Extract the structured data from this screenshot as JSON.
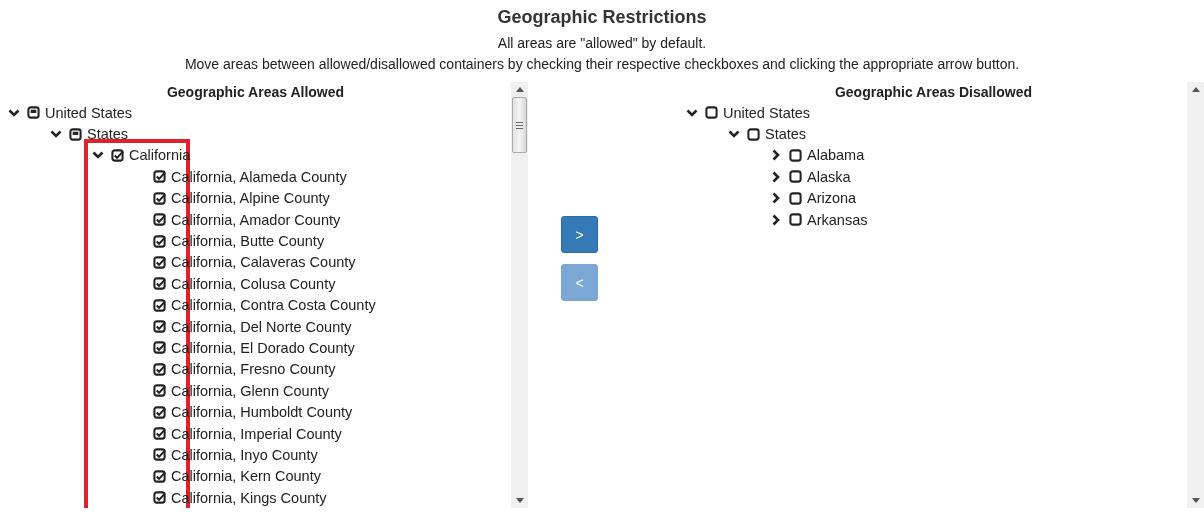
{
  "title": "Geographic Restrictions",
  "intro": [
    "All areas are \"allowed\" by default.",
    "Move areas between allowed/disallowed containers by checking their respective checkboxes and clicking the appropriate arrow button."
  ],
  "allowed": {
    "heading": "Geographic Areas Allowed",
    "tree": [
      {
        "label": "United States",
        "checked": false,
        "partial": true,
        "expanded": true,
        "children": [
          {
            "label": "States",
            "checked": false,
            "partial": true,
            "expanded": true,
            "children": [
              {
                "label": "California",
                "checked": true,
                "partial": false,
                "expanded": true,
                "children": [
                  {
                    "label": "California, Alameda County",
                    "checked": true,
                    "partial": false
                  },
                  {
                    "label": "California, Alpine County",
                    "checked": true,
                    "partial": false
                  },
                  {
                    "label": "California, Amador County",
                    "checked": true,
                    "partial": false
                  },
                  {
                    "label": "California, Butte County",
                    "checked": true,
                    "partial": false
                  },
                  {
                    "label": "California, Calaveras County",
                    "checked": true,
                    "partial": false
                  },
                  {
                    "label": "California, Colusa County",
                    "checked": true,
                    "partial": false
                  },
                  {
                    "label": "California, Contra Costa County",
                    "checked": true,
                    "partial": false
                  },
                  {
                    "label": "California, Del Norte County",
                    "checked": true,
                    "partial": false
                  },
                  {
                    "label": "California, El Dorado County",
                    "checked": true,
                    "partial": false
                  },
                  {
                    "label": "California, Fresno County",
                    "checked": true,
                    "partial": false
                  },
                  {
                    "label": "California, Glenn County",
                    "checked": true,
                    "partial": false
                  },
                  {
                    "label": "California, Humboldt County",
                    "checked": true,
                    "partial": false
                  },
                  {
                    "label": "California, Imperial County",
                    "checked": true,
                    "partial": false
                  },
                  {
                    "label": "California, Inyo County",
                    "checked": true,
                    "partial": false
                  },
                  {
                    "label": "California, Kern County",
                    "checked": true,
                    "partial": false
                  },
                  {
                    "label": "California, Kings County",
                    "checked": true,
                    "partial": false
                  }
                ]
              }
            ]
          }
        ]
      }
    ]
  },
  "buttons": [
    {
      "label": ">",
      "disabled": false
    },
    {
      "label": "<",
      "disabled": true
    }
  ],
  "disallowed": {
    "heading": "Geographic Areas Disallowed",
    "tree": [
      {
        "label": "United States",
        "checked": false,
        "partial": false,
        "expanded": true,
        "children": [
          {
            "label": "States",
            "checked": false,
            "partial": false,
            "expanded": true,
            "children": [
              {
                "label": "Alabama",
                "checked": false,
                "partial": false,
                "expanded": false
              },
              {
                "label": "Alaska",
                "checked": false,
                "partial": false,
                "expanded": false
              },
              {
                "label": "Arizona",
                "checked": false,
                "partial": false,
                "expanded": false
              },
              {
                "label": "Arkansas",
                "checked": false,
                "partial": false,
                "expanded": false
              }
            ]
          }
        ]
      }
    ]
  }
}
